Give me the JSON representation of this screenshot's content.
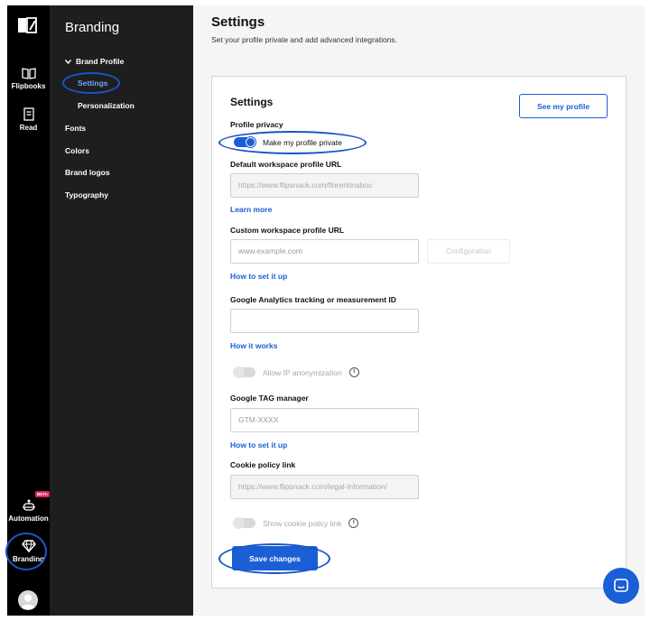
{
  "rail": {
    "items": [
      {
        "label": "Flipbooks",
        "icon": "book-open-icon"
      },
      {
        "label": "Read",
        "icon": "document-icon"
      },
      {
        "label": "Automation",
        "icon": "robot-icon",
        "badge": "BETA"
      },
      {
        "label": "Branding",
        "icon": "diamond-icon"
      }
    ]
  },
  "nav": {
    "title": "Branding",
    "group_label": "Brand Profile",
    "sub_items": [
      "Settings",
      "Personalization"
    ],
    "items": [
      "Fonts",
      "Colors",
      "Brand logos",
      "Typography"
    ]
  },
  "header": {
    "title": "Settings",
    "subtitle": "Set your profile private and add advanced integrations."
  },
  "card": {
    "title": "Settings",
    "see_profile": "See my profile",
    "privacy_label": "Profile privacy",
    "privacy_toggle": "Make my profile private",
    "privacy_on": true,
    "default_url_label": "Default workspace profile URL",
    "default_url_value": "https://www.flipsnack.com/florentinaboc",
    "learn_more": "Learn more",
    "custom_url_label": "Custom workspace profile URL",
    "custom_url_placeholder": "www.example.com",
    "configuration": "Configuration",
    "how_to_1": "How to set it up",
    "ga_label": "Google Analytics tracking or measurement ID",
    "how_it_works": "How it works",
    "allow_ip": "Allow IP anonymization",
    "gtm_label": "Google TAG manager",
    "gtm_placeholder": "GTM-XXXX",
    "how_to_2": "How to set it up",
    "cookie_label": "Cookie policy link",
    "cookie_placeholder": "https://www.flipsnack.com/legal-information/",
    "show_cookie": "Show cookie policy link",
    "save": "Save changes"
  },
  "colors": {
    "accent": "#1a5fd6",
    "rail_bg": "#000000",
    "nav_bg": "#1e1e1e"
  }
}
